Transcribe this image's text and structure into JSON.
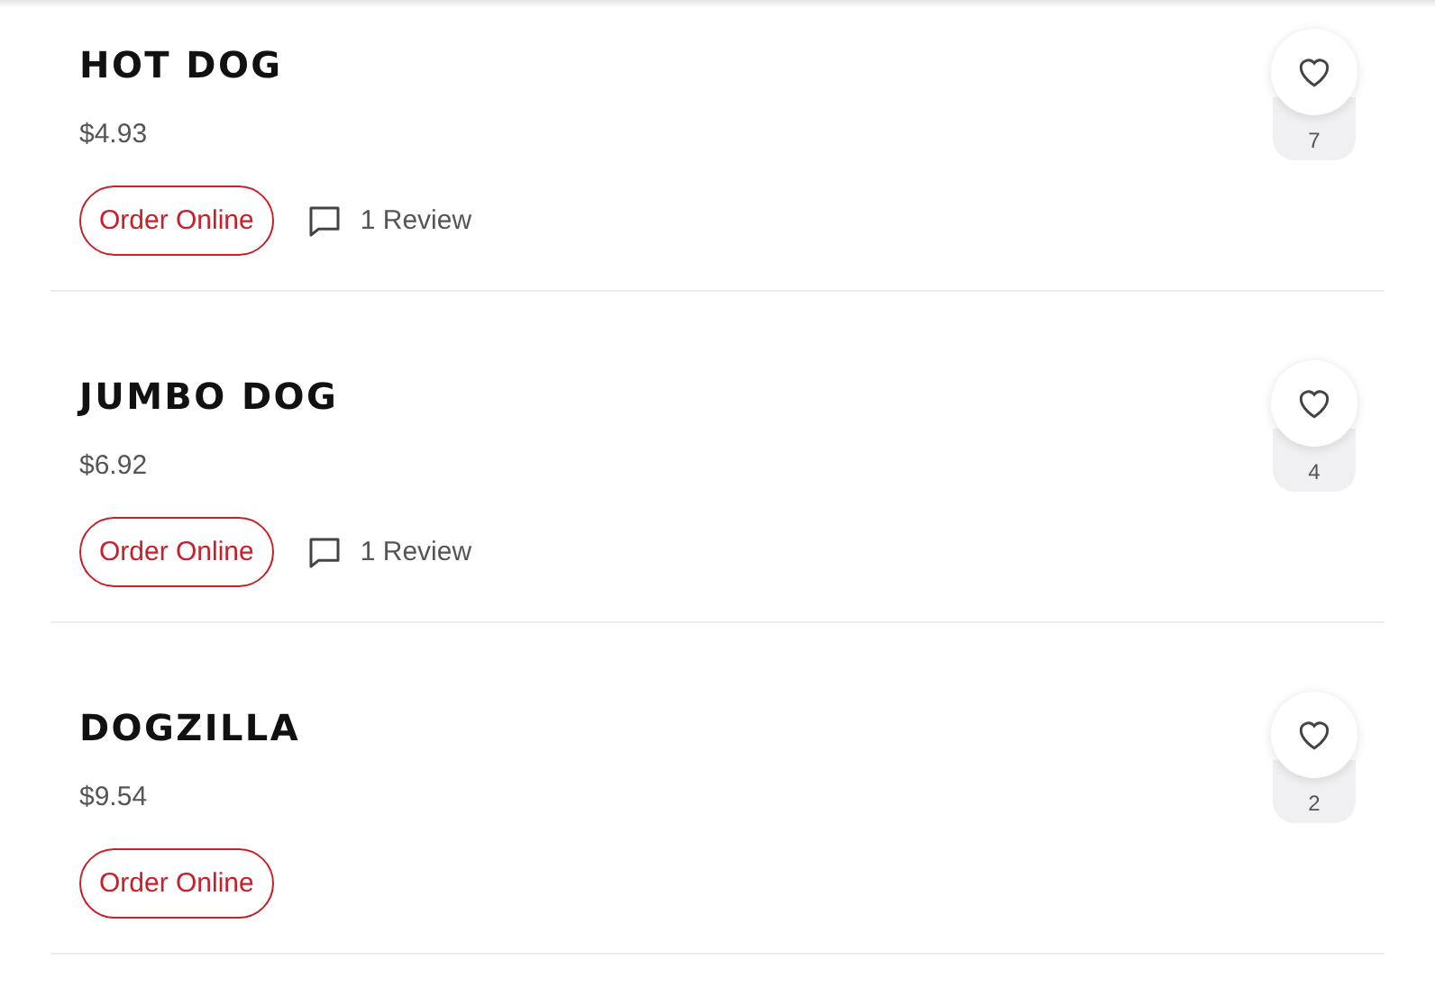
{
  "items": [
    {
      "name": "HOT DOG",
      "price": "$4.93",
      "order_label": "Order Online",
      "reviews": "1 Review",
      "likes": "7"
    },
    {
      "name": "JUMBO DOG",
      "price": "$6.92",
      "order_label": "Order Online",
      "reviews": "1 Review",
      "likes": "4"
    },
    {
      "name": "DOGZILLA",
      "price": "$9.54",
      "order_label": "Order Online",
      "likes": "2"
    }
  ]
}
